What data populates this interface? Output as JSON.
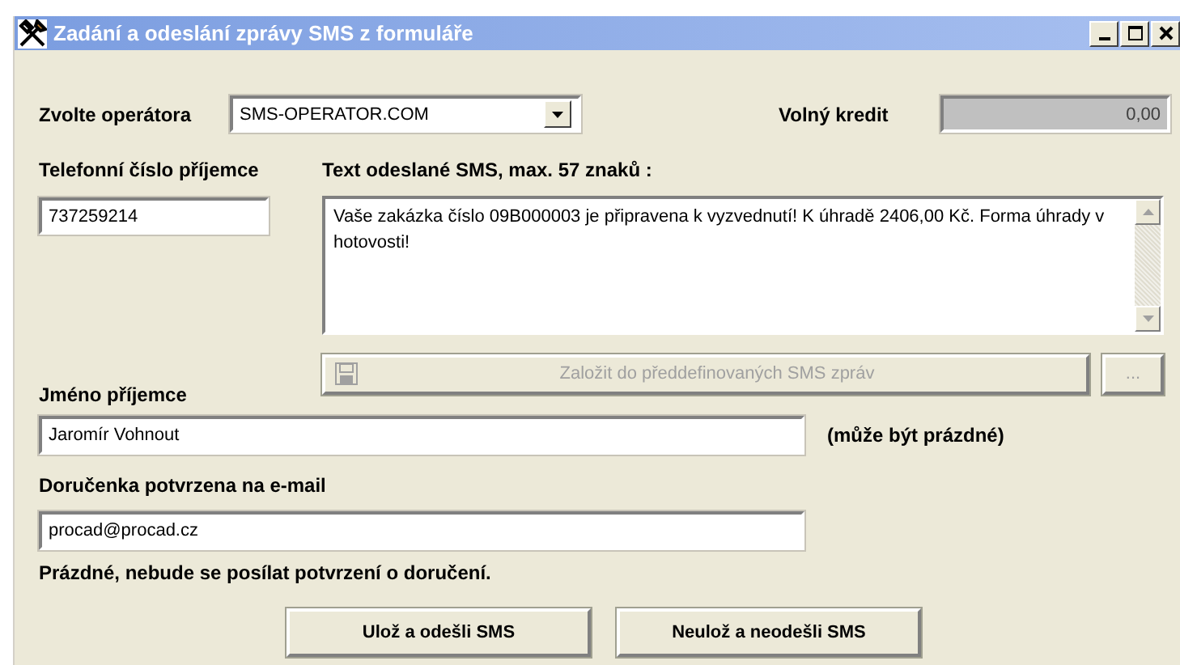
{
  "window": {
    "title": "Zadání a odeslání zprávy SMS z formuláře"
  },
  "operator": {
    "label": "Zvolte operátora",
    "value": "SMS-OPERATOR.COM"
  },
  "credit": {
    "label": "Volný kredit",
    "value": "0,00"
  },
  "phone": {
    "label": "Telefonní číslo příjemce",
    "value": "737259214"
  },
  "message": {
    "label": "Text odeslané SMS, max. 57 znaků :",
    "value": "Vaše zakázka číslo 09B000003 je připravena k vyzvednutí! K úhradě 2406,00 Kč. Forma úhrady v hotovosti!"
  },
  "template_button": {
    "label": "Založit do předdefinovaných SMS zpráv",
    "disabled": true
  },
  "more_button": {
    "label": "...",
    "disabled": true
  },
  "recipient": {
    "label": "Jméno příjemce",
    "value": "Jaromír Vohnout",
    "note": "(může být prázdné)"
  },
  "email": {
    "label": "Doručenka potvrzena na e-mail",
    "value": "procad@procad.cz",
    "note": "Prázdné, nebude se posílat potvrzení o doručení."
  },
  "buttons": [
    "Ulož a odešli SMS",
    "Neulož a neodešli SMS"
  ]
}
